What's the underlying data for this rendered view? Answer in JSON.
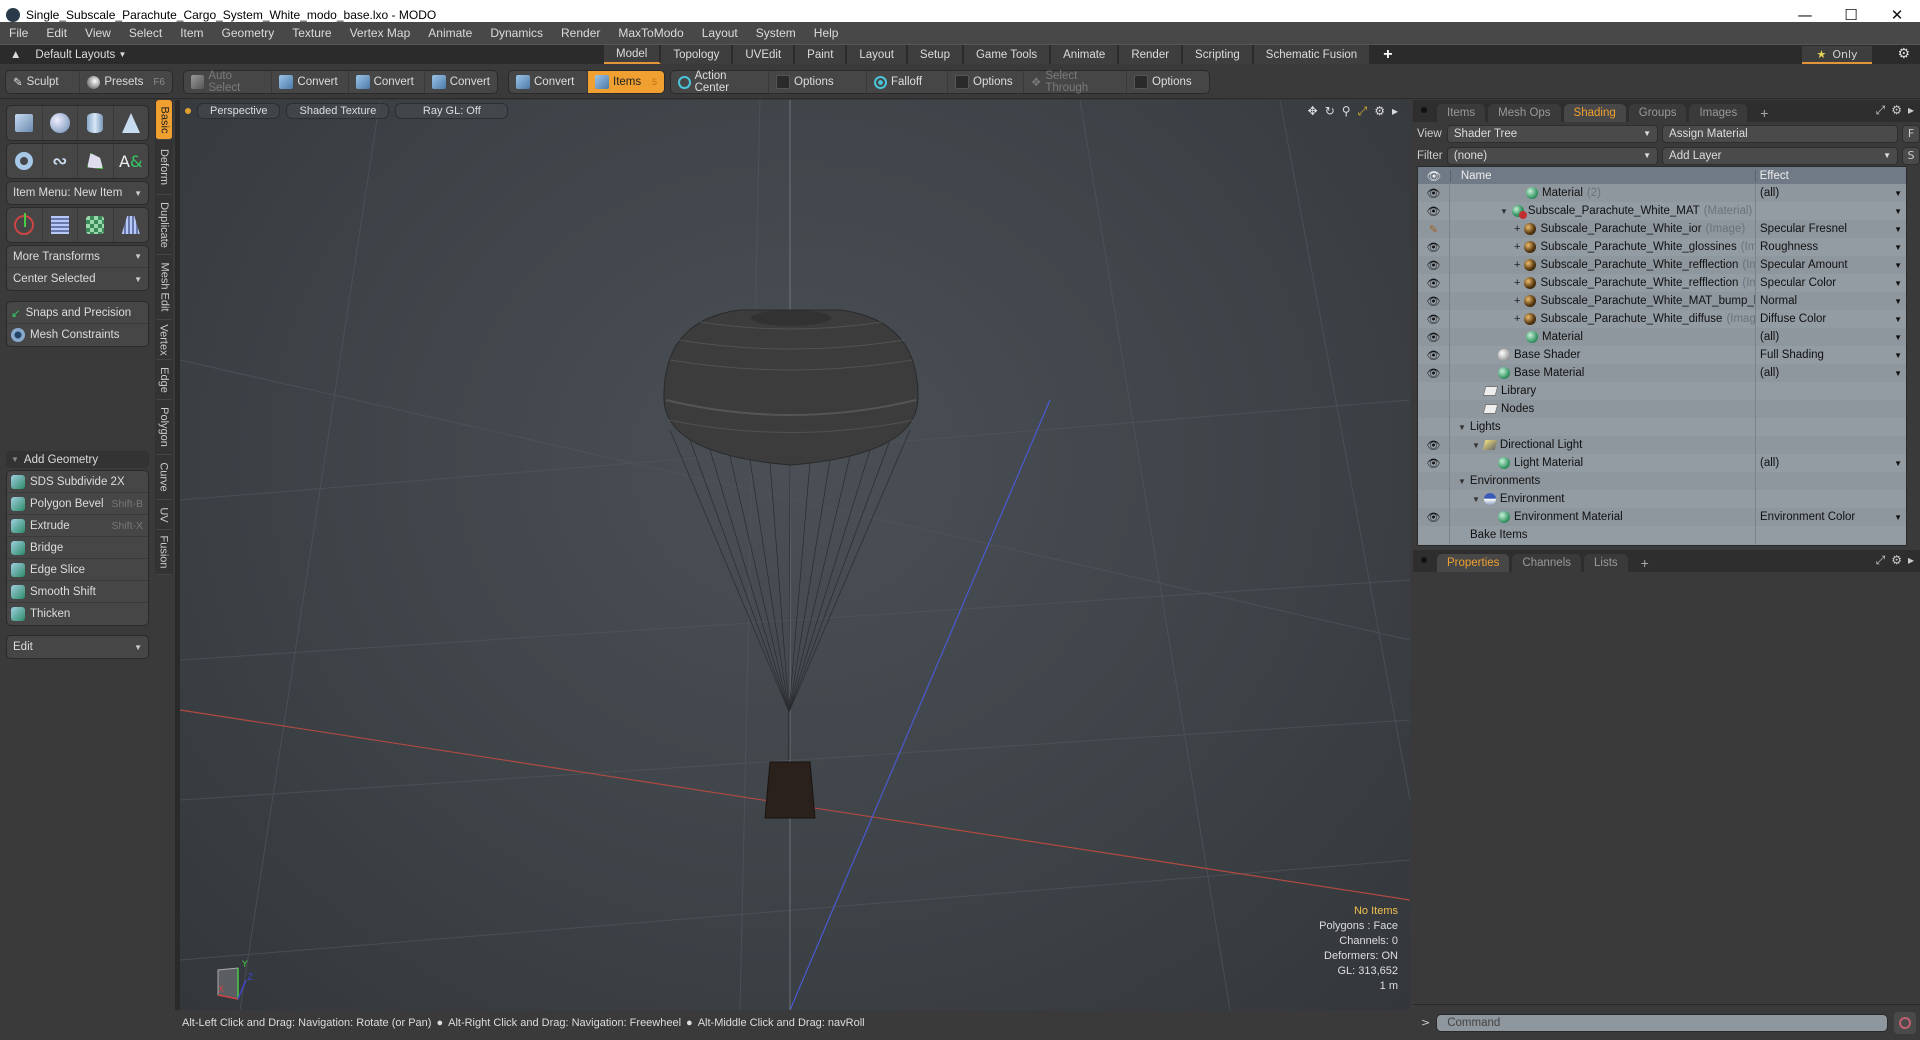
{
  "window": {
    "title": "Single_Subscale_Parachute_Cargo_System_White_modo_base.lxo - MODO",
    "controls": [
      "minimize",
      "maximize",
      "close"
    ]
  },
  "menubar": [
    "File",
    "Edit",
    "View",
    "Select",
    "Item",
    "Geometry",
    "Texture",
    "Vertex Map",
    "Animate",
    "Dynamics",
    "Render",
    "MaxToModo",
    "Layout",
    "System",
    "Help"
  ],
  "layoutbar": {
    "layouts_label": "Default Layouts",
    "tabs": [
      "Model",
      "Topology",
      "UVEdit",
      "Paint",
      "Layout",
      "Setup",
      "Game Tools",
      "Animate",
      "Render",
      "Scripting",
      "Schematic Fusion"
    ],
    "active_tab": "Model",
    "only_label": "Only"
  },
  "toolbar": {
    "sculpt": "Sculpt",
    "presets": "Presets",
    "presets_shortcut": "F6",
    "auto_select": "Auto Select",
    "convert1": "Convert",
    "convert2": "Convert",
    "convert3": "Convert",
    "convert4": "Convert",
    "items": "Items",
    "items_count": "5",
    "action_center": "Action Center",
    "options1": "Options",
    "falloff": "Falloff",
    "options2": "Options",
    "select_through": "Select Through",
    "options3": "Options"
  },
  "leftpanel": {
    "item_menu": "Item Menu: New Item",
    "more_transforms": "More Transforms",
    "center_selected": "Center Selected",
    "snaps": "Snaps and Precision",
    "mesh_constraints": "Mesh Constraints",
    "add_geometry": "Add Geometry",
    "tools": [
      {
        "label": "SDS Subdivide 2X",
        "shortcut": ""
      },
      {
        "label": "Polygon Bevel",
        "shortcut": "Shift-B"
      },
      {
        "label": "Extrude",
        "shortcut": "Shift-X"
      },
      {
        "label": "Bridge",
        "shortcut": ""
      },
      {
        "label": "Edge Slice",
        "shortcut": ""
      },
      {
        "label": "Smooth Shift",
        "shortcut": ""
      },
      {
        "label": "Thicken",
        "shortcut": ""
      }
    ],
    "edit_dropdown": "Edit",
    "vtabs": [
      "Basic",
      "Deform",
      "Duplicate",
      "Mesh Edit",
      "Vertex",
      "Edge",
      "Polygon",
      "Curve",
      "UV",
      "Fusion"
    ]
  },
  "viewport": {
    "view_mode": "Perspective",
    "shading": "Shaded Texture",
    "raygl": "Ray GL: Off",
    "info": {
      "selection": "No Items",
      "polygons": "Polygons : Face",
      "channels": "Channels: 0",
      "deformers": "Deformers: ON",
      "gl": "GL: 313,652",
      "scale": "1 m"
    },
    "axis_labels": {
      "x": "X",
      "y": "Y",
      "z": "Z"
    }
  },
  "statusbar": {
    "hint1": "Alt-Left Click and Drag: Navigation: Rotate (or Pan)",
    "hint2": "Alt-Right Click and Drag: Navigation: Freewheel",
    "hint3": "Alt-Middle Click and Drag: navRoll"
  },
  "rightpanel": {
    "tabs": [
      "Items",
      "Mesh Ops",
      "Shading",
      "Groups",
      "Images"
    ],
    "active_tab": "Shading",
    "view_label": "View",
    "view_value": "Shader Tree",
    "assign_material": "Assign Material",
    "f_btn": "F",
    "filter_label": "Filter",
    "filter_value": "(none)",
    "add_layer": "Add Layer",
    "s_btn": "S",
    "columns": {
      "name": "Name",
      "effect": "Effect"
    },
    "rows": [
      {
        "name": "Material",
        "type": "(2)",
        "effect": "(all)",
        "icon": "green",
        "indent": 4,
        "eye": true,
        "dd": true
      },
      {
        "name": "Subscale_Parachute_White_MAT",
        "type": "(Material)",
        "effect": "",
        "icon": "mat",
        "indent": 3,
        "eye": true,
        "dd": true,
        "expand": "tri"
      },
      {
        "name": "Subscale_Parachute_White_ior",
        "type": "(Image)",
        "effect": "Specular Fresnel",
        "icon": "img",
        "indent": 4,
        "eye": "brush",
        "dd": true,
        "expand": "plus"
      },
      {
        "name": "Subscale_Parachute_White_glossines",
        "type": "(Image)",
        "effect": "Roughness",
        "icon": "img",
        "indent": 4,
        "eye": true,
        "dd": true,
        "expand": "plus"
      },
      {
        "name": "Subscale_Parachute_White_refflection",
        "type": "(Ima...",
        "effect": "Specular Amount",
        "icon": "img",
        "indent": 4,
        "eye": true,
        "dd": true,
        "expand": "plus"
      },
      {
        "name": "Subscale_Parachute_White_refflection",
        "type": "(Ima...",
        "effect": "Specular Color",
        "icon": "img",
        "indent": 4,
        "eye": true,
        "dd": true,
        "expand": "plus"
      },
      {
        "name": "Subscale_Parachute_White_MAT_bump_bak...",
        "type": "",
        "effect": "Normal",
        "icon": "img",
        "indent": 4,
        "eye": true,
        "dd": true,
        "expand": "plus"
      },
      {
        "name": "Subscale_Parachute_White_diffuse",
        "type": "(Image)",
        "effect": "Diffuse Color",
        "icon": "img",
        "indent": 4,
        "eye": true,
        "dd": true,
        "expand": "plus"
      },
      {
        "name": "Material",
        "type": "",
        "effect": "(all)",
        "icon": "green",
        "indent": 4,
        "eye": true,
        "dd": true
      },
      {
        "name": "Base Shader",
        "type": "",
        "effect": "Full Shading",
        "icon": "white",
        "indent": 2,
        "eye": true,
        "dd": true
      },
      {
        "name": "Base Material",
        "type": "",
        "effect": "(all)",
        "icon": "green",
        "indent": 2,
        "eye": true,
        "dd": true
      },
      {
        "name": "Library",
        "type": "",
        "effect": "",
        "icon": "folder",
        "indent": 1,
        "eye": false,
        "dd": false
      },
      {
        "name": "Nodes",
        "type": "",
        "effect": "",
        "icon": "folder",
        "indent": 1,
        "eye": false,
        "dd": false
      },
      {
        "name": "Lights",
        "type": "",
        "effect": "",
        "icon": "",
        "indent": 0,
        "eye": false,
        "dd": false,
        "expand": "tri"
      },
      {
        "name": "Directional Light",
        "type": "",
        "effect": "",
        "icon": "light",
        "indent": 1,
        "eye": true,
        "dd": false,
        "expand": "tri"
      },
      {
        "name": "Light Material",
        "type": "",
        "effect": "(all)",
        "icon": "green",
        "indent": 2,
        "eye": true,
        "dd": true
      },
      {
        "name": "Environments",
        "type": "",
        "effect": "",
        "icon": "",
        "indent": 0,
        "eye": false,
        "dd": false,
        "expand": "tri"
      },
      {
        "name": "Environment",
        "type": "",
        "effect": "",
        "icon": "env",
        "indent": 1,
        "eye": false,
        "dd": false,
        "expand": "tri"
      },
      {
        "name": "Environment Material",
        "type": "",
        "effect": "Environment Color",
        "icon": "green",
        "indent": 2,
        "eye": true,
        "dd": true
      },
      {
        "name": "Bake Items",
        "type": "",
        "effect": "",
        "icon": "",
        "indent": 0,
        "eye": false,
        "dd": false
      }
    ],
    "props_tabs": [
      "Properties",
      "Channels",
      "Lists"
    ],
    "props_active": "Properties",
    "command_placeholder": "Command"
  },
  "colors": {
    "accent": "#f0a030",
    "tree_bg": "#8e969e",
    "viewport_bg": "#3e4348"
  }
}
